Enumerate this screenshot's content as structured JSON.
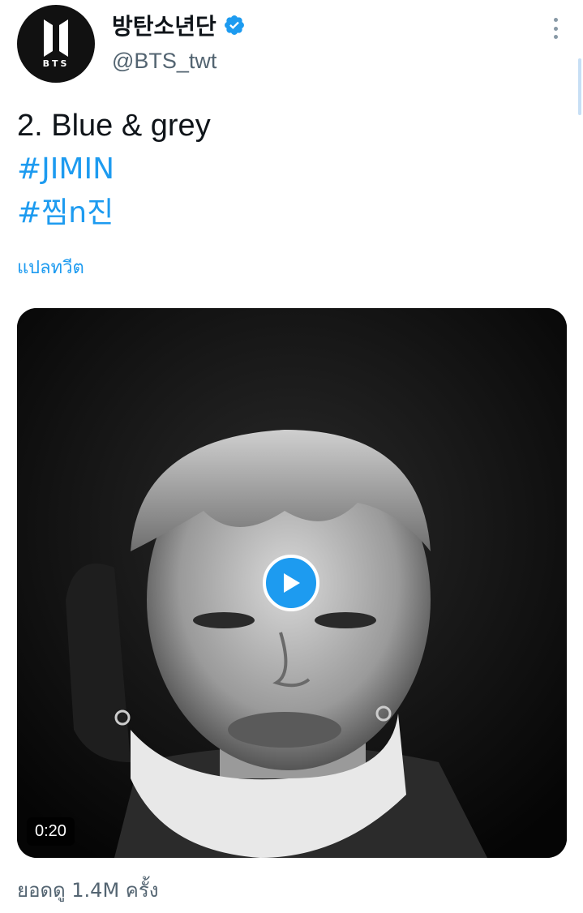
{
  "account": {
    "display_name": "방탄소년단",
    "handle": "@BTS_twt",
    "avatar_logo_text": "BTS",
    "verified": true
  },
  "tweet": {
    "text_line_1": "2. Blue & grey",
    "hashtag_1": "#JIMIN",
    "hashtag_2": "#찜n진",
    "translate_label": "แปลทวีต"
  },
  "media": {
    "type": "video",
    "duration": "0:20"
  },
  "stats": {
    "views_label": "ยอดดู 1.4M ครั้ง"
  },
  "colors": {
    "link": "#1d9bf0",
    "secondary_text": "#536471",
    "verified_badge": "#1d9bf0"
  },
  "icons": {
    "verified": "verified-badge-icon",
    "more": "more-vertical-icon",
    "play": "play-icon"
  }
}
